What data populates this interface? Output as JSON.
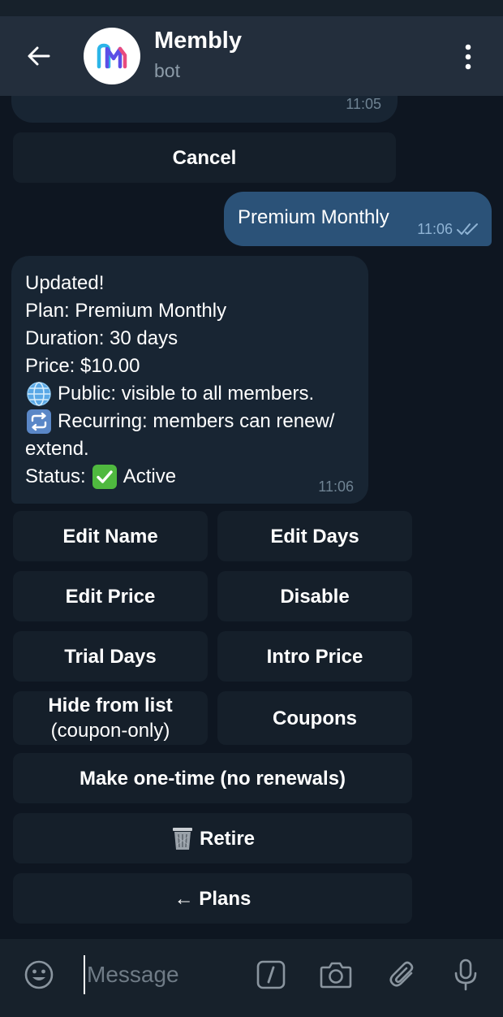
{
  "header": {
    "title": "Membly",
    "subtitle": "bot",
    "avatar_icon": "membly-logo-icon",
    "back_icon": "arrow-left-icon",
    "menu_icon": "more-vertical-icon"
  },
  "messages": {
    "previous_time": "11:05",
    "cancel_button": "Cancel",
    "outgoing": {
      "text": "Premium Monthly",
      "time": "11:06",
      "status_icon": "double-check-icon"
    },
    "incoming": {
      "lines": [
        "Updated!",
        "Plan: Premium Monthly",
        "Duration: 30 days",
        "Price: $10.00",
        "Public: visible to all members.",
        "Recurring: members can renew/",
        "extend.",
        "Status:",
        "Active"
      ],
      "time": "11:06"
    }
  },
  "keyboard": {
    "edit_name": "Edit Name",
    "edit_days": "Edit Days",
    "edit_price": "Edit Price",
    "disable": "Disable",
    "trial_days": "Trial Days",
    "intro_price": "Intro Price",
    "hide_line1": "Hide from list",
    "hide_line2": "(coupon-only)",
    "coupons": "Coupons",
    "make_one_time": "Make one-time (no renewals)",
    "retire": "Retire",
    "plans": "← Plans"
  },
  "composer": {
    "placeholder": "Message",
    "icons": [
      "emoji-icon",
      "bot-command-icon",
      "camera-icon",
      "attach-icon",
      "microphone-icon"
    ]
  },
  "colors": {
    "background": "#0e1621",
    "header": "#232e3c",
    "incoming_bubble": "#182533",
    "outgoing_bubble": "#2b5278",
    "keyboard_button": "#151f2a"
  }
}
